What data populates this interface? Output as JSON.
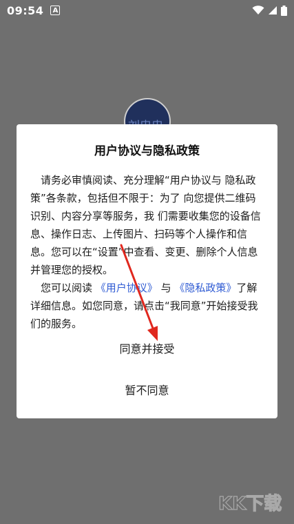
{
  "status_bar": {
    "time": "09:54",
    "notification_icon_letter": "A",
    "icons": [
      "wifi-icon",
      "signal-icon",
      "battery-icon"
    ]
  },
  "background": {
    "avatar_text": "刘忠忠"
  },
  "dialog": {
    "title": "用户协议与隐私政策",
    "paragraph1": "请务必审慎阅读、充分理解“用户协议与 隐私政策”各条款，包括但不限于：为了 向您提供二维码识别、内容分享等服务，我 们需要收集您的设备信息、操作日志、上传图片、扫码等个人操作和信息。您可以在“设置”中查看、变更、删除个人信息并管理您的授权。",
    "paragraph2_prefix": "您可以阅读 ",
    "user_agreement_link": "《用户协议》",
    "paragraph2_and": " 与 ",
    "privacy_policy_link": "《隐私政策》",
    "paragraph2_suffix": "了解详细信息。如您同意，请点击“我同意”开始接受我们的服务。",
    "agree_button": "同意并接受",
    "disagree_button": "暂不同意"
  },
  "annotation": {
    "arrow_color": "#e0281e"
  },
  "watermark": {
    "text": "KK下载"
  }
}
